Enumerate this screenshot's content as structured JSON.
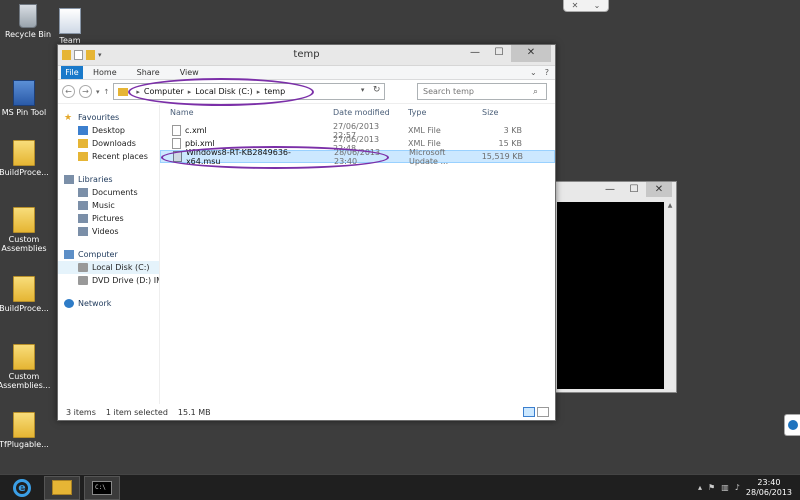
{
  "desktop": {
    "icons": [
      {
        "label": "Recycle Bin"
      },
      {
        "label": "Team"
      },
      {
        "label": "MS Pin Tool"
      },
      {
        "label": "BuildProce..."
      },
      {
        "label": "Custom Assemblies"
      },
      {
        "label": "BuildProce..."
      },
      {
        "label": "Custom Assemblies..."
      },
      {
        "label": "TfPlugable..."
      }
    ]
  },
  "explorer": {
    "title": "temp",
    "ribbon": {
      "file": "File",
      "home": "Home",
      "share": "Share",
      "view": "View"
    },
    "address": {
      "computer": "Computer",
      "disk": "Local Disk (C:)",
      "folder": "temp"
    },
    "search_placeholder": "Search temp",
    "nav": {
      "favourites": {
        "label": "Favourites",
        "items": [
          "Desktop",
          "Downloads",
          "Recent places"
        ]
      },
      "libraries": {
        "label": "Libraries",
        "items": [
          "Documents",
          "Music",
          "Pictures",
          "Videos"
        ]
      },
      "computer": {
        "label": "Computer",
        "items": [
          "Local Disk (C:)",
          "DVD Drive (D:) IMP_("
        ]
      },
      "network": {
        "label": "Network"
      }
    },
    "columns": {
      "name": "Name",
      "date": "Date modified",
      "type": "Type",
      "size": "Size"
    },
    "files": [
      {
        "name": "c.xml",
        "date": "27/06/2013 22:57",
        "type": "XML File",
        "size": "3 KB"
      },
      {
        "name": "pbi.xml",
        "date": "27/06/2013 22:48",
        "type": "XML File",
        "size": "15 KB"
      },
      {
        "name": "Windows8-RT-KB2849636-x64.msu",
        "date": "28/06/2013 23:40",
        "type": "Microsoft Update ...",
        "size": "15,519 KB"
      }
    ],
    "status": {
      "count": "3 items",
      "selected": "1 item selected",
      "size": "15.1 MB"
    }
  },
  "taskbar": {
    "time": "23:40",
    "date": "28/06/2013"
  },
  "colors": {
    "annotation": "#7b2fa8",
    "file_tab": "#1979ca",
    "selection": "#cce8ff"
  }
}
